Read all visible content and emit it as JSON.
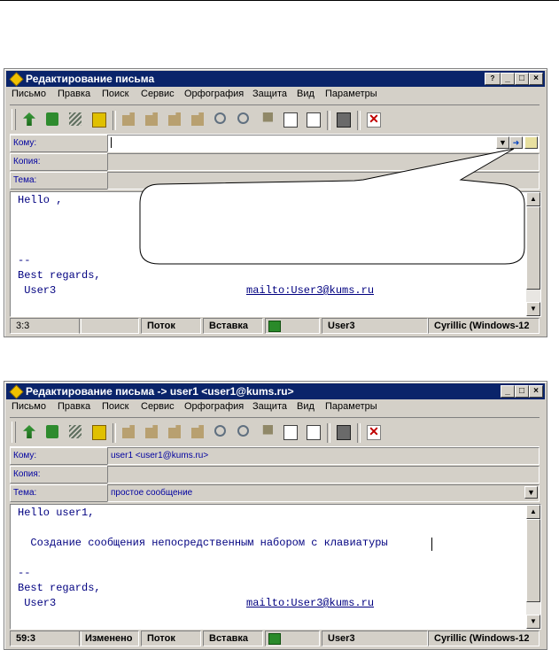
{
  "windows": [
    {
      "title": "Редактирование письма",
      "has_help_button": true,
      "menu": [
        "Письмо",
        "Правка",
        "Поиск",
        "Сервис",
        "Орфография",
        "Защита",
        "Вид",
        "Параметры"
      ],
      "headers": {
        "to_label": "Кому:",
        "to_value": "",
        "cc_label": "Копия:",
        "cc_value": "",
        "subject_label": "Тема:",
        "subject_value": ""
      },
      "body_lines": {
        "greeting": "Hello ,",
        "sig_sep": "--",
        "regards": "Best regards,",
        "name": " User3",
        "mailto": "mailto:User3@kums.ru"
      },
      "status": {
        "position": "3:3",
        "modified": "",
        "mode": "Поток",
        "insert": "Вставка",
        "user": "User3",
        "encoding": "Cyrillic (Windows-12"
      }
    },
    {
      "title": "Редактирование письма -> user1 <user1@kums.ru>",
      "has_help_button": false,
      "menu": [
        "Письмо",
        "Правка",
        "Поиск",
        "Сервис",
        "Орфография",
        "Защита",
        "Вид",
        "Параметры"
      ],
      "headers": {
        "to_label": "Кому:",
        "to_value": "user1 <user1@kums.ru>",
        "cc_label": "Копия:",
        "cc_value": "",
        "subject_label": "Тема:",
        "subject_value": "простое сообщение"
      },
      "body_lines": {
        "greeting": "Hello user1,",
        "message": "  Создание сообщения непосредственным набором с клавиатуры",
        "sig_sep": "--",
        "regards": "Best regards,",
        "name": " User3",
        "mailto": "mailto:User3@kums.ru"
      },
      "status": {
        "position": "59:3",
        "modified": "Изменено",
        "mode": "Поток",
        "insert": "Вставка",
        "user": "User3",
        "encoding": "Cyrillic (Windows-12"
      }
    }
  ],
  "toolbar_icons": [
    "send-icon",
    "send-later-icon",
    "sign-icon",
    "save-icon",
    "cut-icon",
    "copy-icon",
    "paste-icon",
    "paste-special-icon",
    "find-icon",
    "replace-icon",
    "insert-icon",
    "attach-icon",
    "attach-file-icon",
    "address-book-icon",
    "delete-icon"
  ],
  "colors": {
    "titlebar": "#0a246a",
    "window": "#d4d0c8",
    "text_blue": "#000080"
  }
}
